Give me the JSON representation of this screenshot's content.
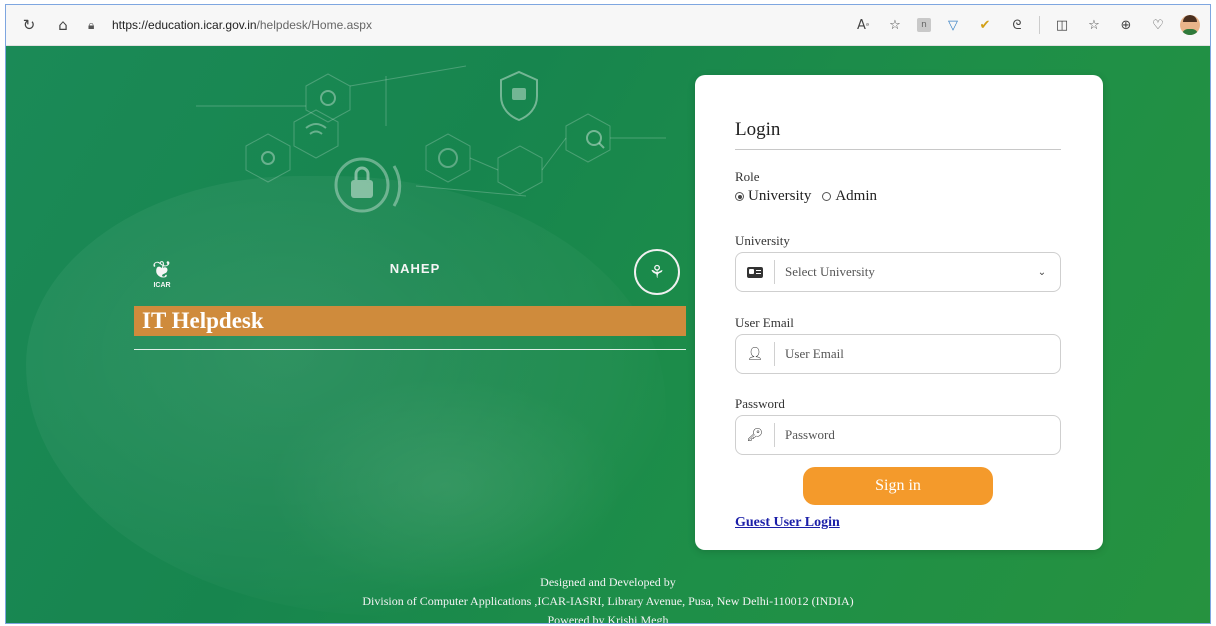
{
  "browser": {
    "url_host": "https://education.icar.gov.in",
    "url_path": "/helpdesk/Home.aspx",
    "toolbar_icons": [
      "refresh-icon",
      "home-icon",
      "read-aloud-icon",
      "favorite-star-icon",
      "extension-n-icon",
      "shield-extension-icon",
      "check-extension-icon",
      "copilot-icon",
      "split-screen-icon",
      "favorites-icon",
      "collections-icon",
      "health-icon",
      "profile-avatar"
    ]
  },
  "branding": {
    "logos": [
      "icar-logo",
      "nahep-logo",
      "university-seal-logo"
    ],
    "nahep_text": "NAHEP",
    "icar_text": "ICAR",
    "banner_title": "IT Helpdesk"
  },
  "login": {
    "title": "Login",
    "role_label": "Role",
    "role_options": [
      "University",
      "Admin"
    ],
    "role_selected": "University",
    "university_label": "University",
    "university_select": "Select University",
    "email_label": "User Email",
    "email_placeholder": "User Email",
    "password_label": "Password",
    "password_placeholder": "Password",
    "signin_label": "Sign in",
    "guest_label": "Guest User Login"
  },
  "footer": {
    "line1": "Designed and Developed by",
    "line2": "Division of Computer Applications ,ICAR-IASRI, Library Avenue, Pusa, New Delhi-110012 (INDIA)",
    "line3": "Powered by Krishi Megh"
  },
  "colors": {
    "background_green": "#1b8a57",
    "banner_orange": "#cf8b3c",
    "signin_orange": "#f49a2b",
    "link_blue": "#1b1fa8"
  }
}
